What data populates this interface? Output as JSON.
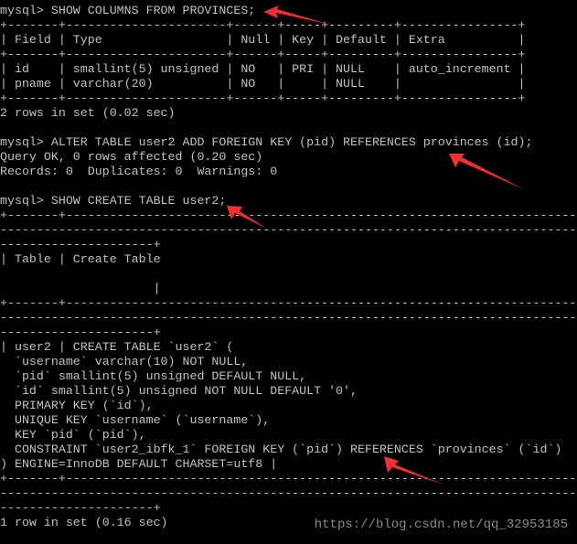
{
  "terminal": {
    "lines": [
      "mysql> SHOW COLUMNS FROM PROVINCES;",
      "+-------+----------------------+------+-----+---------+----------------+",
      "| Field | Type                 | Null | Key | Default | Extra          |",
      "+-------+----------------------+------+-----+---------+----------------+",
      "| id    | smallint(5) unsigned | NO   | PRI | NULL    | auto_increment |",
      "| pname | varchar(20)          | NO   |     | NULL    |                |",
      "+-------+----------------------+------+-----+---------+----------------+",
      "2 rows in set (0.02 sec)",
      "",
      "mysql> ALTER TABLE user2 ADD FOREIGN KEY (pid) REFERENCES provinces (id);",
      "Query OK, 0 rows affected (0.20 sec)",
      "Records: 0  Duplicates: 0  Warnings: 0",
      "",
      "mysql> SHOW CREATE TABLE user2;",
      "+-------+-------------------------------------------------------------------------------",
      "---------------------------------------------------------------------------------------",
      "---------------------+",
      "| Table | Create Table",
      "",
      "                     |",
      "+-------+-------------------------------------------------------------------------------",
      "---------------------------------------------------------------------------------------",
      "---------------------+",
      "| user2 | CREATE TABLE `user2` (",
      "  `username` varchar(10) NOT NULL,",
      "  `pid` smallint(5) unsigned DEFAULT NULL,",
      "  `id` smallint(5) unsigned NOT NULL DEFAULT '0',",
      "  PRIMARY KEY (`id`),",
      "  UNIQUE KEY `username` (`username`),",
      "  KEY `pid` (`pid`),",
      "  CONSTRAINT `user2_ibfk_1` FOREIGN KEY (`pid`) REFERENCES `provinces` (`id`)",
      ") ENGINE=InnoDB DEFAULT CHARSET=utf8 |",
      "+-------+-------------------------------------------------------------------------------",
      "---------------------------------------------------------------------------------------",
      "---------------------+",
      "1 row in set (0.16 sec)"
    ]
  },
  "watermark": "https://blog.csdn.net/qq_32953185",
  "colors": {
    "background": "#000000",
    "text": "#c0c0c0",
    "arrow": "#f03030"
  }
}
